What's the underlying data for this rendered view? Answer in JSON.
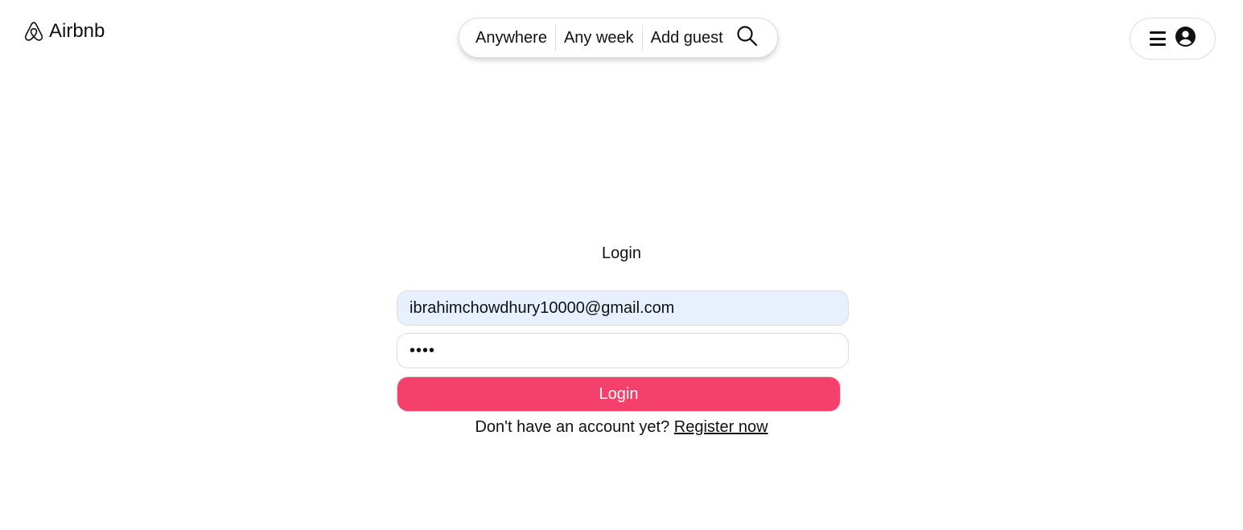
{
  "header": {
    "logo_text": "Airbnb",
    "logo_icon": "airbnb-logo-icon",
    "search": {
      "where": "Anywhere",
      "when": "Any week",
      "who": "Add guest",
      "search_icon": "search-icon"
    },
    "user_menu": {
      "menu_icon": "hamburger-menu-icon",
      "avatar_icon": "user-circle-icon"
    }
  },
  "login": {
    "title": "Login",
    "email_value": "ibrahimchowdhury10000@gmail.com",
    "password_value": "1234",
    "submit_label": "Login",
    "register_prompt": "Don't have an account yet?",
    "register_link": "Register now"
  },
  "colors": {
    "accent": "#f5406b",
    "email_autofill_bg": "#e8f0fe",
    "border": "#dddddd"
  }
}
